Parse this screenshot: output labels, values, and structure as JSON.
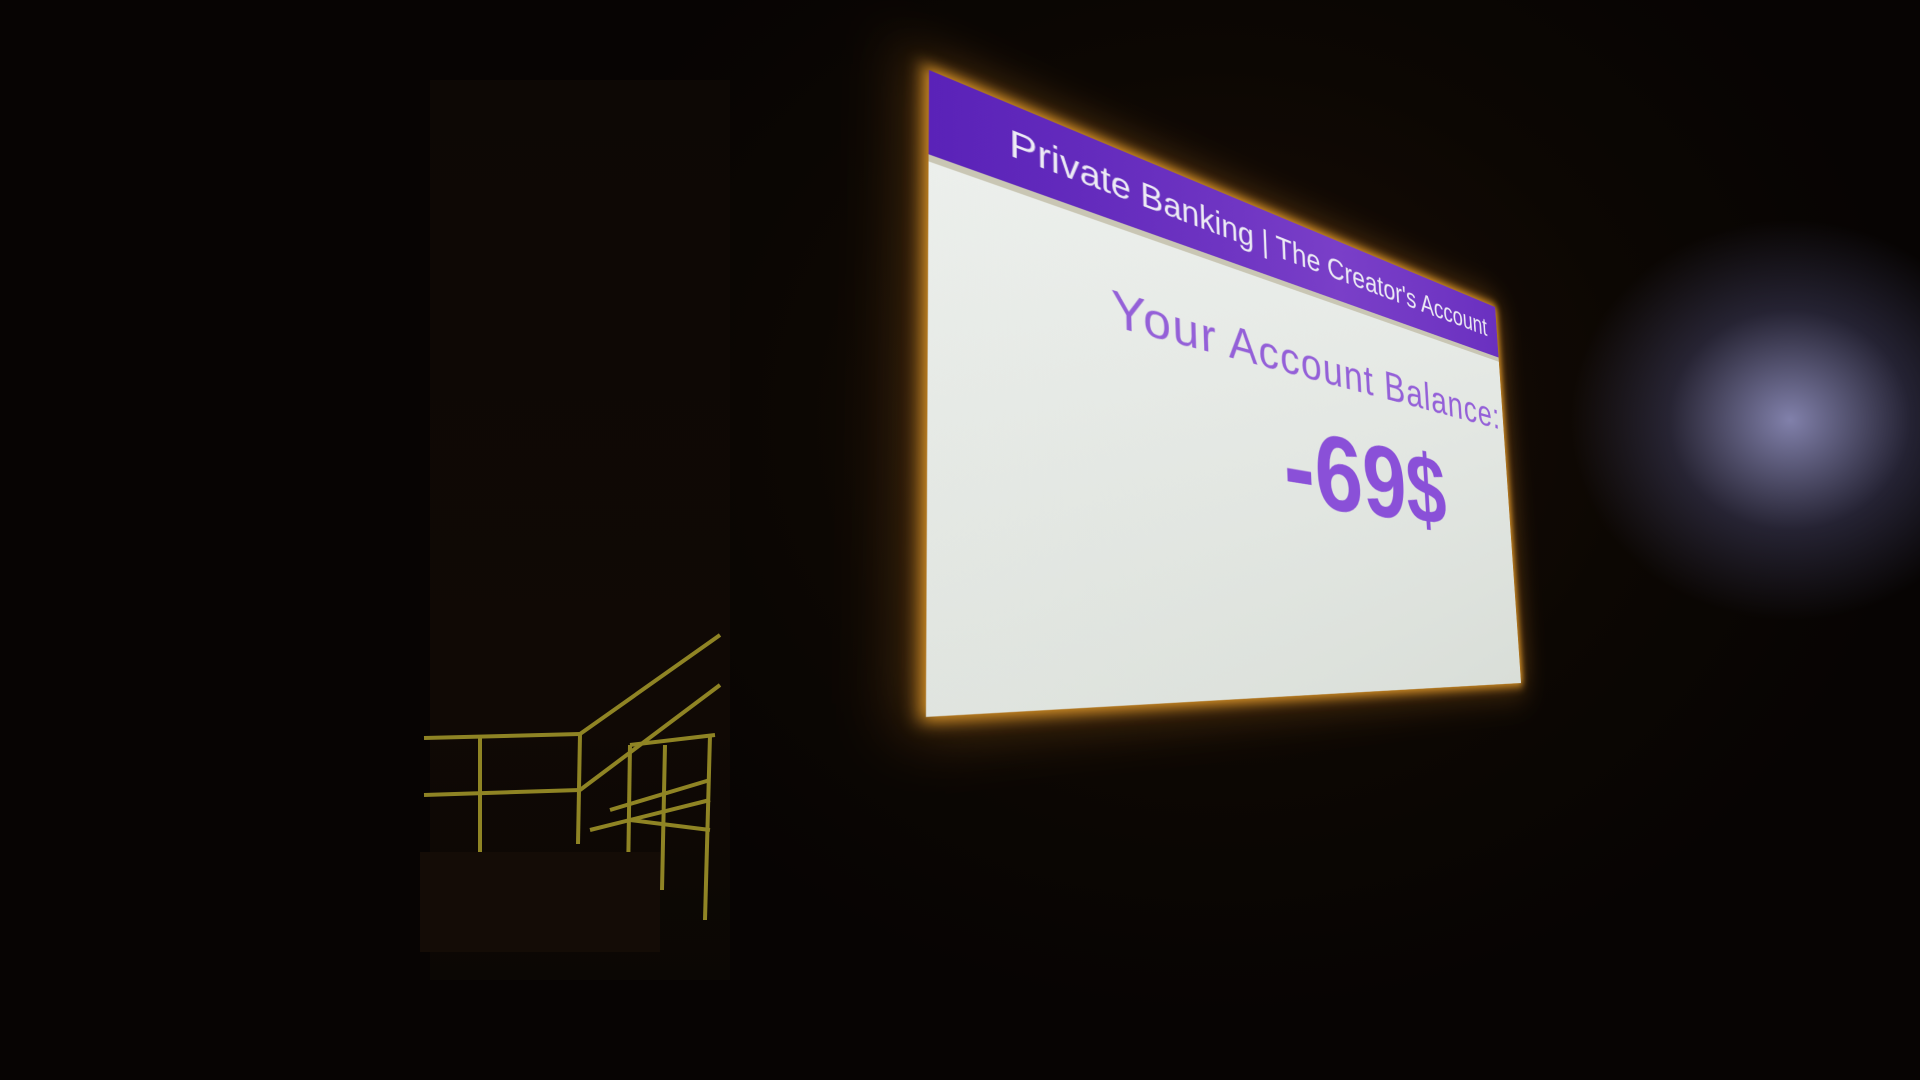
{
  "screen": {
    "header_title": "Private Banking | The Creator's Account",
    "balance_label": "Your Account Balance:",
    "balance_value": "-69$"
  },
  "colors": {
    "header": "#6a30c0",
    "accent_text": "#8a50d8",
    "glow": "#e39b2a"
  }
}
